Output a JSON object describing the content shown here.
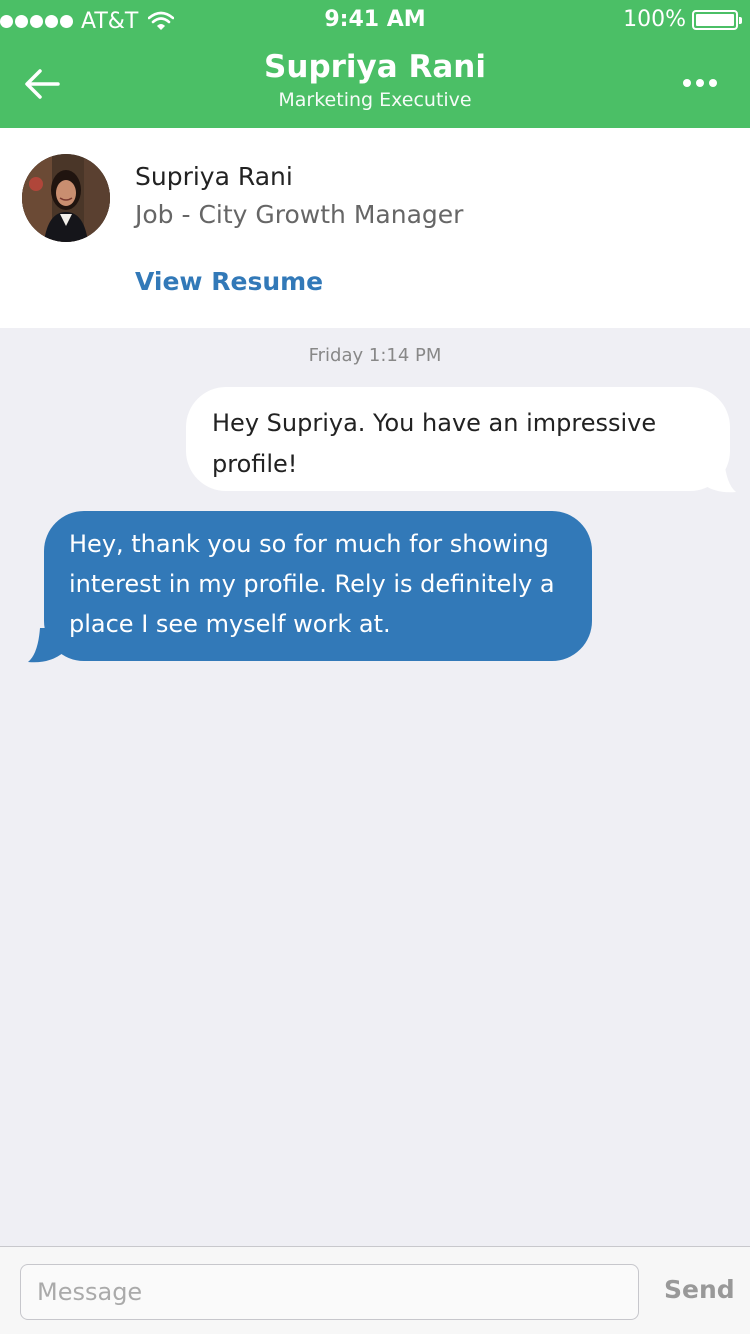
{
  "status_bar": {
    "carrier": "AT&T",
    "time": "9:41 AM",
    "battery": "100%"
  },
  "header": {
    "title": "Supriya Rani",
    "subtitle": "Marketing Executive"
  },
  "profile": {
    "name": "Supriya Rani",
    "job": "Job - City Growth Manager",
    "view_resume_label": "View Resume"
  },
  "chat": {
    "timestamp": "Friday 1:14 PM",
    "messages": [
      {
        "direction": "outgoing",
        "text": "Hey Supriya. You have an impressive profile!"
      },
      {
        "direction": "incoming",
        "text": "Hey, thank you so for much for showing interest in my profile. Rely is definitely a place I see myself work at."
      }
    ]
  },
  "composer": {
    "placeholder": "Message",
    "send_label": "Send"
  },
  "colors": {
    "header_green": "#4bbf66",
    "accent_blue": "#3279b8",
    "background": "#efeff4"
  }
}
